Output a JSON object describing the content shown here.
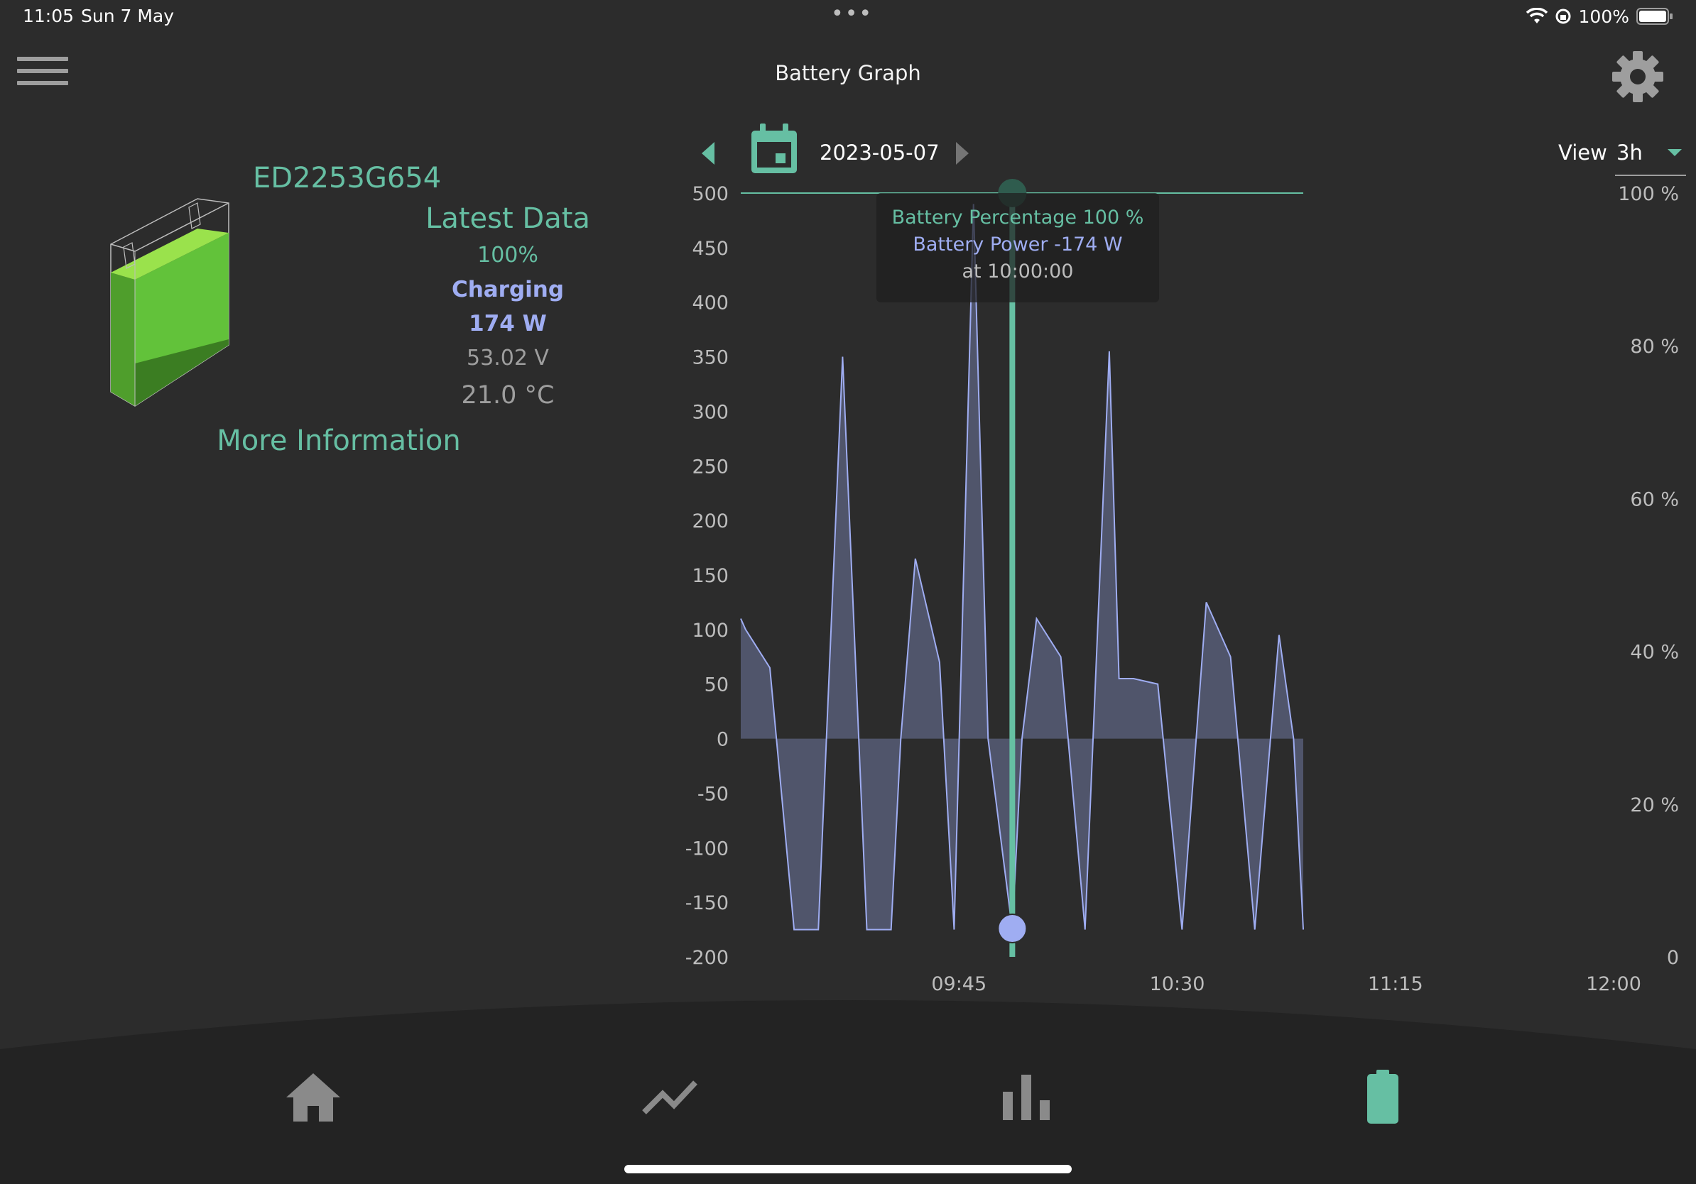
{
  "status": {
    "time": "11:05",
    "date": "Sun 7 May",
    "battery_pct": "100%"
  },
  "header": {
    "title": "Battery Graph"
  },
  "icons": {
    "menu": "hamburger-icon",
    "settings": "gear-icon",
    "calendar": "calendar-icon",
    "prev": "chevron-left-icon",
    "next": "chevron-right-icon"
  },
  "device": {
    "id": "ED2253G654"
  },
  "latest": {
    "title": "Latest Data",
    "percentage": "100%",
    "status": "Charging",
    "power": "174 W",
    "voltage": "53.02 V",
    "temperature": "21.0 °C"
  },
  "more_info_label": "More Information",
  "date_nav": {
    "date": "2023-05-07"
  },
  "view": {
    "label": "View",
    "value": "3h"
  },
  "tooltip": {
    "percentage": "Battery Percentage 100 %",
    "power": "Battery Power -174 W",
    "time": "at 10:00:00"
  },
  "colors": {
    "accent": "#66bfa3",
    "power": "#9fadf2",
    "background": "#2c2c2c",
    "nav_bg": "#232323"
  },
  "chart_data": {
    "type": "area",
    "x_tick_labels": [
      "09:45",
      "10:30",
      "11:15",
      "12:00"
    ],
    "y_left": {
      "ticks": [
        "500",
        "450",
        "400",
        "350",
        "300",
        "250",
        "200",
        "150",
        "100",
        "50",
        "0",
        "-50",
        "-100",
        "-150",
        "-200"
      ],
      "range": [
        -200,
        500
      ]
    },
    "y_right": {
      "ticks": [
        "100 %",
        "80 %",
        "60 %",
        "40 %",
        "20 %",
        "0"
      ],
      "range": [
        0,
        100
      ]
    },
    "x_range_minutes": [
      0,
      180
    ],
    "series": [
      {
        "name": "Battery Power",
        "x_minutes": [
          0,
          1,
          6,
          11,
          16,
          21,
          26,
          31,
          33,
          36,
          41,
          44,
          48,
          51,
          56,
          58,
          61,
          66,
          71,
          76,
          78,
          81,
          86,
          91,
          96,
          101,
          106,
          111,
          114,
          116
        ],
        "values": [
          110,
          100,
          65,
          -175,
          -175,
          350,
          -175,
          -175,
          0,
          165,
          70,
          -175,
          490,
          0,
          -175,
          0,
          110,
          75,
          -175,
          355,
          55,
          55,
          50,
          -175,
          125,
          75,
          -175,
          95,
          0,
          -175
        ]
      },
      {
        "name": "Battery Percentage",
        "x_minutes": [
          0,
          116
        ],
        "values": [
          100,
          100
        ]
      }
    ],
    "selected": {
      "x_minutes": 56,
      "power": -174,
      "percentage": 100
    }
  },
  "nav": [
    "home-icon",
    "trend-line-icon",
    "bar-chart-icon",
    "battery-icon"
  ]
}
